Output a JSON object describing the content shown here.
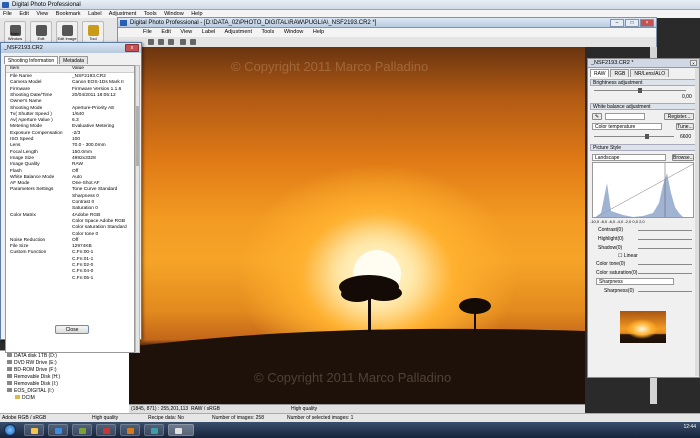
{
  "main_window": {
    "title": "Digital Photo Professional",
    "menu": [
      "File",
      "Edit",
      "View",
      "Bookmark",
      "Label",
      "Adjustment",
      "Tools",
      "Window",
      "Help"
    ],
    "toolbar": [
      "Main Window",
      "Edit",
      "Edit Image",
      "Tool"
    ]
  },
  "edit_window": {
    "title": "Digital Photo Professional - [D:\\DATA_02\\PHOTO_DIGITAL\\RAW\\PUGLIA\\_NSF2193.CR2 *]",
    "menu": [
      "File",
      "Edit",
      "View",
      "Label",
      "Adjustment",
      "Tools",
      "Window",
      "Help"
    ],
    "watermark": "© Copyright 2011 Marco Palladino",
    "status": {
      "coords": "(1845, 871) : 255,201,113",
      "color_space": "RAW / sRGB",
      "quality": "High quality"
    }
  },
  "shooting_info": {
    "title": "_NSF2193.CR2",
    "close_x": "x",
    "tabs": [
      "Shooting Information",
      "Metadata"
    ],
    "header": {
      "key": "Item",
      "value": "Value"
    },
    "rows": [
      {
        "k": "File Name",
        "v": "_NSF2193.CR2"
      },
      {
        "k": "Camera Model",
        "v": "Canon EOS-1Ds Mark II"
      },
      {
        "k": "Firmware",
        "v": "Firmware Version 1.1.6"
      },
      {
        "k": "Shooting Date/Time",
        "v": "20/04/2011 18:05:12"
      },
      {
        "k": "Owner's Name",
        "v": ""
      },
      {
        "k": "Shooting Mode",
        "v": "Aperture-Priority AE"
      },
      {
        "k": "Tv( Shutter Speed )",
        "v": "1/640"
      },
      {
        "k": "Av( Aperture Value )",
        "v": "6.3"
      },
      {
        "k": "Metering Mode",
        "v": "Evaluative Metering"
      },
      {
        "k": "Exposure Compensation",
        "v": "-2/3"
      },
      {
        "k": "ISO Speed",
        "v": "100"
      },
      {
        "k": "Lens",
        "v": "70.0 - 300.0mm"
      },
      {
        "k": "Focal Length",
        "v": "150.0mm"
      },
      {
        "k": "Image Size",
        "v": "4992x3328"
      },
      {
        "k": "Image Quality",
        "v": "RAW"
      },
      {
        "k": "Flash",
        "v": "Off"
      },
      {
        "k": "White Balance Mode",
        "v": "Auto"
      },
      {
        "k": "AF Mode",
        "v": "One-Shot AF"
      },
      {
        "k": "Parameters Settings",
        "v": "Tone Curve  Standard"
      },
      {
        "k": "",
        "v": "Sharpness   0"
      },
      {
        "k": "",
        "v": "Contrast    0"
      },
      {
        "k": "",
        "v": "Saturation  0"
      },
      {
        "k": "Color Matrix",
        "v": "4Adobe RGB"
      },
      {
        "k": "",
        "v": "Color Space   Adobe RGB"
      },
      {
        "k": "",
        "v": "Color saturation  Standard"
      },
      {
        "k": "",
        "v": "Color tone   0"
      },
      {
        "k": "Noise Reduction",
        "v": "Off"
      },
      {
        "k": "File Size",
        "v": "12974KB"
      },
      {
        "k": "Custom Function",
        "v": "C.Fn:00-1"
      },
      {
        "k": "",
        "v": "C.Fn:01-1"
      },
      {
        "k": "",
        "v": "C.Fn:02-0"
      },
      {
        "k": "",
        "v": "C.Fn:04-0"
      },
      {
        "k": "",
        "v": "C.Fn:05-1"
      }
    ],
    "close_button": "Close"
  },
  "tool_palette": {
    "title": "_NSF2193.CR2 *",
    "tabs": [
      "RAW",
      "RGB",
      "NR/Lens/ALO"
    ],
    "brightness": {
      "label": "Brightness adjustment",
      "value": "0,00"
    },
    "white_balance": {
      "label": "White balance adjustment",
      "register": "Register...",
      "mode": "Color temperature",
      "tune": "Tune...",
      "temp": "6600"
    },
    "picture_style": {
      "label": "Picture Style",
      "style": "Landscape",
      "browse": "Browse...",
      "ticks": [
        "-10,0",
        "-8,0",
        "-6,0",
        "-4,0",
        "-2,0",
        "0,0",
        "2,0"
      ],
      "contrast": "Contrast(0)",
      "highlight": "Highlight(0)",
      "shadow": "Shadow(0)",
      "linear": "Linear",
      "color_tone": "Color tone(0)",
      "color_saturation": "Color saturation(0)",
      "sharpness_mode": "Sharpness",
      "sharpness": "Sharpness(0)"
    }
  },
  "file_tree": [
    "DATA disk 1TB (D:)",
    "DVD RW Drive (E:)",
    "BD-ROM Drive (F:)",
    "Removable Disk (H:)",
    "Removable Disk (I:)",
    "EOS_DIGITAL (I:)",
    "DCIM"
  ],
  "status_bar": {
    "color": "Adobe RGB / sRGB",
    "quality": "High quality",
    "recipe": "Recipe data: No",
    "images": "Number of images: 258",
    "selected": "Number of selected images: 1"
  },
  "taskbar": {
    "time": "12:44",
    "date": ""
  }
}
